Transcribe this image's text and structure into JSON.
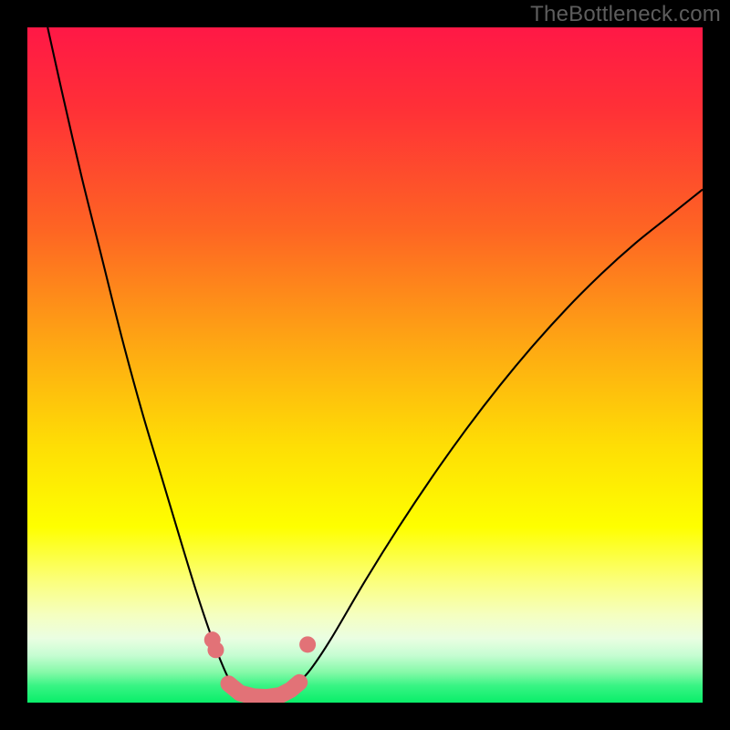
{
  "watermark": "TheBottleneck.com",
  "chart_data": {
    "type": "line",
    "title": "",
    "xlabel": "",
    "ylabel": "",
    "xlim": [
      0,
      100
    ],
    "ylim": [
      0,
      100
    ],
    "grid": false,
    "legend": false,
    "background_gradient_stops": [
      {
        "offset": 0.0,
        "color": "#ff1846"
      },
      {
        "offset": 0.12,
        "color": "#ff3037"
      },
      {
        "offset": 0.3,
        "color": "#fe6523"
      },
      {
        "offset": 0.48,
        "color": "#feab12"
      },
      {
        "offset": 0.62,
        "color": "#fede05"
      },
      {
        "offset": 0.74,
        "color": "#feff00"
      },
      {
        "offset": 0.82,
        "color": "#fbff7c"
      },
      {
        "offset": 0.87,
        "color": "#f5ffc0"
      },
      {
        "offset": 0.905,
        "color": "#eafee2"
      },
      {
        "offset": 0.93,
        "color": "#c6fdd2"
      },
      {
        "offset": 0.955,
        "color": "#85f9a8"
      },
      {
        "offset": 0.975,
        "color": "#38f484"
      },
      {
        "offset": 1.0,
        "color": "#09ee69"
      }
    ],
    "series": [
      {
        "name": "bottleneck-curve",
        "stroke": "#000000",
        "stroke_width": 2.1,
        "points": [
          {
            "x": 3.0,
            "y": 100.0
          },
          {
            "x": 5.0,
            "y": 91.0
          },
          {
            "x": 8.0,
            "y": 78.0
          },
          {
            "x": 11.0,
            "y": 66.0
          },
          {
            "x": 14.0,
            "y": 54.0
          },
          {
            "x": 17.0,
            "y": 43.0
          },
          {
            "x": 20.0,
            "y": 33.0
          },
          {
            "x": 23.0,
            "y": 23.0
          },
          {
            "x": 25.0,
            "y": 16.5
          },
          {
            "x": 27.0,
            "y": 10.5
          },
          {
            "x": 28.5,
            "y": 6.5
          },
          {
            "x": 30.0,
            "y": 3.2
          },
          {
            "x": 31.5,
            "y": 1.5
          },
          {
            "x": 33.0,
            "y": 0.7
          },
          {
            "x": 35.0,
            "y": 0.5
          },
          {
            "x": 37.0,
            "y": 0.7
          },
          {
            "x": 38.5,
            "y": 1.4
          },
          {
            "x": 40.0,
            "y": 2.8
          },
          {
            "x": 42.0,
            "y": 5.0
          },
          {
            "x": 45.0,
            "y": 9.5
          },
          {
            "x": 50.0,
            "y": 18.0
          },
          {
            "x": 55.0,
            "y": 26.0
          },
          {
            "x": 60.0,
            "y": 33.5
          },
          {
            "x": 65.0,
            "y": 40.5
          },
          {
            "x": 70.0,
            "y": 47.0
          },
          {
            "x": 75.0,
            "y": 53.0
          },
          {
            "x": 80.0,
            "y": 58.5
          },
          {
            "x": 85.0,
            "y": 63.5
          },
          {
            "x": 90.0,
            "y": 68.0
          },
          {
            "x": 95.0,
            "y": 72.0
          },
          {
            "x": 100.0,
            "y": 76.0
          }
        ]
      },
      {
        "name": "trough-markers",
        "stroke": "#e27277",
        "fill": "#e27277",
        "marker_radius": 9,
        "stroke_width": 18,
        "points": [
          {
            "x": 27.4,
            "y": 9.3
          },
          {
            "x": 27.9,
            "y": 7.8
          },
          {
            "x": 29.8,
            "y": 2.8
          },
          {
            "x": 31.5,
            "y": 1.4
          },
          {
            "x": 33.5,
            "y": 0.9
          },
          {
            "x": 35.5,
            "y": 0.8
          },
          {
            "x": 37.5,
            "y": 1.1
          },
          {
            "x": 39.0,
            "y": 1.9
          },
          {
            "x": 40.3,
            "y": 3.0
          },
          {
            "x": 41.5,
            "y": 8.6
          }
        ]
      }
    ]
  }
}
